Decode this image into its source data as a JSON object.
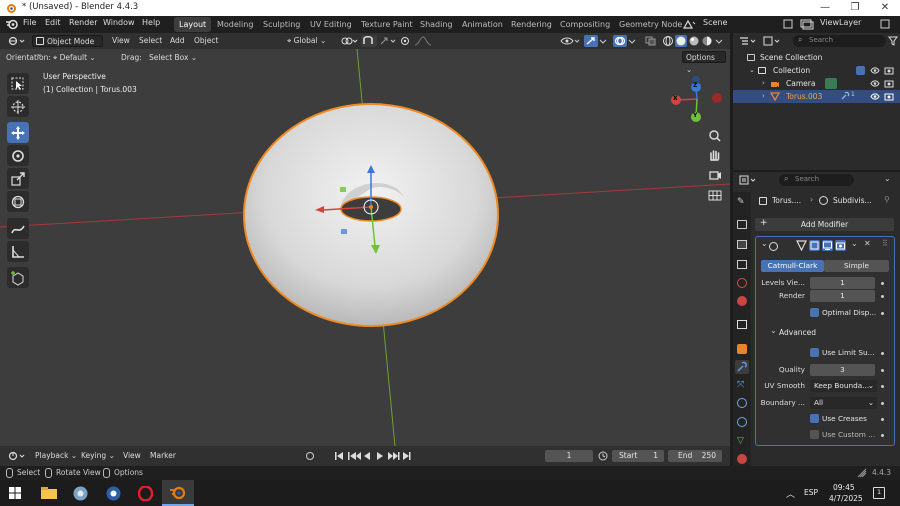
{
  "window": {
    "title": "* (Unsaved) - Blender 4.4.3",
    "min": "—",
    "max": "❐",
    "close": "✕"
  },
  "menu": [
    "File",
    "Edit",
    "Render",
    "Window",
    "Help"
  ],
  "workspaces": [
    "Layout",
    "Modeling",
    "Sculpting",
    "UV Editing",
    "Texture Paint",
    "Shading",
    "Animation",
    "Rendering",
    "Compositing",
    "Geometry Node"
  ],
  "scene": "Scene",
  "view_layer": "ViewLayer",
  "viewport_header": {
    "mode": "Object Mode",
    "view": "View",
    "select": "Select",
    "add": "Add",
    "object": "Object",
    "transform": "Global"
  },
  "tool_header": {
    "orientation_label": "Orientation:",
    "orientation_value": "Default",
    "drag_label": "Drag:",
    "drag_value": "Select Box",
    "options": "Options"
  },
  "viewport_info": {
    "line1": "User Perspective",
    "line2": "(1) Collection | Torus.003"
  },
  "gizmo": {
    "x": "X",
    "y": "Y",
    "z": "Z"
  },
  "outliner": {
    "search_placeholder": "Search",
    "scene_collection": "Scene Collection",
    "collection": "Collection",
    "camera": "Camera",
    "torus": "Torus.003",
    "modifier_count": "1"
  },
  "properties": {
    "search_placeholder": "Search",
    "breadcrumb_object": "Torus....",
    "breadcrumb_modifier": "Subdivis...",
    "add_modifier": "Add Modifier",
    "tab_catmull": "Catmull-Clark",
    "tab_simple": "Simple",
    "levels_label": "Levels Vie...",
    "levels_value": "1",
    "render_label": "Render",
    "render_value": "1",
    "optimal_display": "Optimal Disp...",
    "advanced": "Advanced",
    "use_limit": "Use Limit Su...",
    "quality_label": "Quality",
    "quality_value": "3",
    "uv_smooth_label": "UV Smooth",
    "uv_smooth_value": "Keep Bounda...",
    "boundary_label": "Boundary ...",
    "boundary_value": "All",
    "use_creases": "Use Creases",
    "use_custom": "Use Custom ..."
  },
  "timeline": {
    "playback": "Playback",
    "keying": "Keying",
    "view": "View",
    "marker": "Marker",
    "current_frame": "1",
    "start_label": "Start",
    "start": "1",
    "end_label": "End",
    "end": "250"
  },
  "statusbar": {
    "select": "Select",
    "rotate": "Rotate View",
    "options": "Options",
    "version": "4.4.3"
  },
  "taskbar": {
    "lang": "ESP",
    "time": "09:45",
    "date": "4/7/2025",
    "notif": "1"
  }
}
